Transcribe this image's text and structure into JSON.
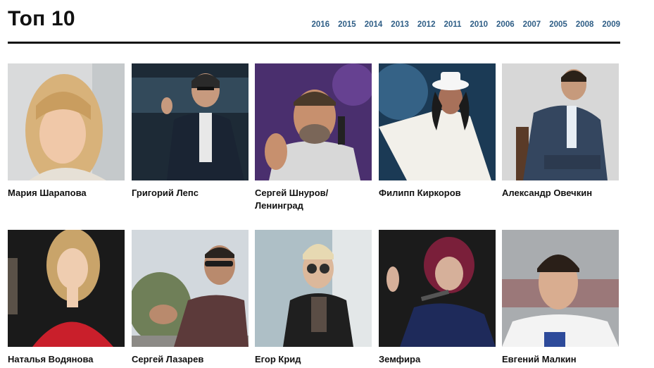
{
  "header": {
    "title": "Топ 10",
    "years": [
      "2016",
      "2015",
      "2014",
      "2013",
      "2012",
      "2011",
      "2010",
      "2006",
      "2007",
      "2005",
      "2008",
      "2009"
    ]
  },
  "people": [
    {
      "name": "Мария Шарапова",
      "photo": "maria-sharapova-photo"
    },
    {
      "name": "Григорий Лепс",
      "photo": "grigory-leps-photo"
    },
    {
      "name": "Сергей Шнуров/ Ленинград",
      "photo": "sergey-shnurov-photo"
    },
    {
      "name": "Филипп Киркоров",
      "photo": "philipp-kirkorov-photo"
    },
    {
      "name": "Александр Овечкин",
      "photo": "alexander-ovechkin-photo"
    },
    {
      "name": "Наталья Водянова",
      "photo": "natalia-vodianova-photo"
    },
    {
      "name": "Сергей Лазарев",
      "photo": "sergey-lazarev-photo"
    },
    {
      "name": "Егор Крид",
      "photo": "egor-kreed-photo"
    },
    {
      "name": "Земфира",
      "photo": "zemfira-photo"
    },
    {
      "name": "Евгений Малкин",
      "photo": "evgeni-malkin-photo"
    }
  ],
  "colors": {
    "accent": "#2f5e86",
    "text": "#111111",
    "rule": "#111111"
  }
}
